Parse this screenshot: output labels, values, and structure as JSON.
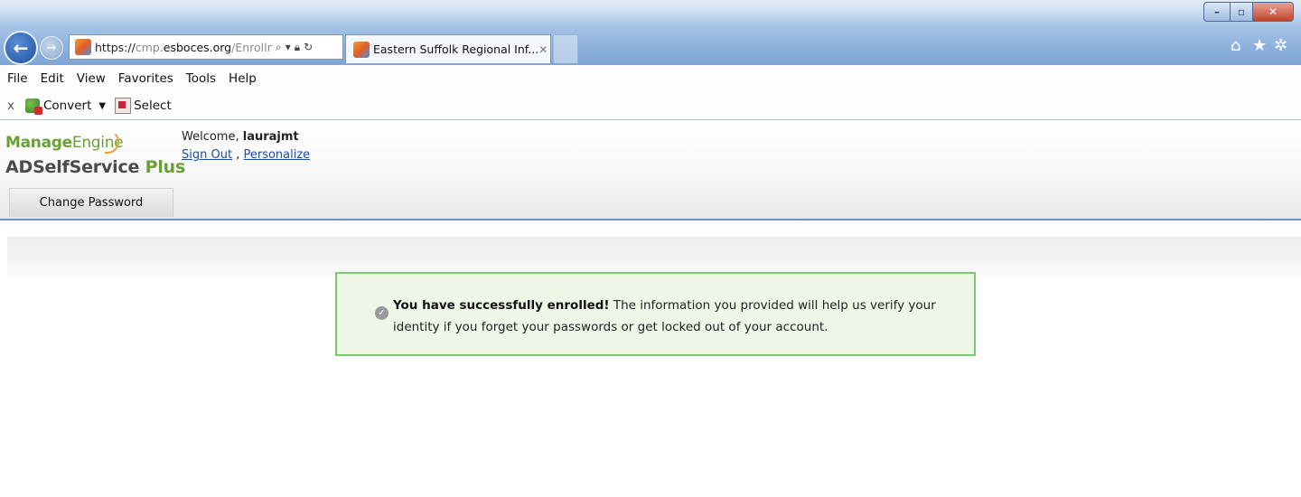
{
  "browser": {
    "address_prefix": "https://",
    "address_sub": "cmp.",
    "address_domain": "esboces.org",
    "address_path": "/Enrolln",
    "tab_title": "Eastern Suffolk Regional Inf...",
    "window_controls": [
      "minimize",
      "maximize",
      "close"
    ],
    "menu": [
      "File",
      "Edit",
      "View",
      "Favorites",
      "Tools",
      "Help"
    ],
    "command_bar": {
      "close": "x",
      "convert": "Convert",
      "select": "Select"
    }
  },
  "app": {
    "logo_manage": "Manage",
    "logo_engine": "Engine",
    "logo_ad": "ADSelfService",
    "logo_plus": "Plus",
    "welcome_label": "Welcome,",
    "username": "laurajmt",
    "sign_out": "Sign Out",
    "separator": ",",
    "personalize": "Personalize",
    "nav_tab": "Change Password"
  },
  "message": {
    "strong": "You have successfully enrolled!",
    "text": "The information you provided will help us verify your identity if you forget your passwords or get locked out of your account."
  },
  "colors": {
    "success_border": "#7dc96f",
    "success_bg": "#eef6e8",
    "link": "#1b4fa8",
    "brand_green": "#6aa035"
  }
}
